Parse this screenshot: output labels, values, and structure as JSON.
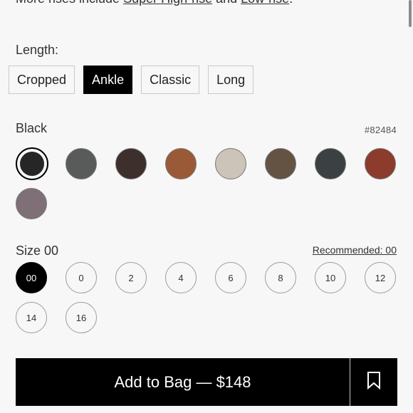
{
  "rise_note": {
    "prefix": "More rises include ",
    "link1": "Super High-rise",
    "middle": " and ",
    "link2": "Low-rise",
    "suffix": "."
  },
  "length": {
    "label": "Length:",
    "options": [
      "Cropped",
      "Ankle",
      "Classic",
      "Long"
    ],
    "selected": "Ankle"
  },
  "color": {
    "name": "Black",
    "code": "#82484",
    "swatches": [
      {
        "color": "#262626",
        "selected": true
      },
      {
        "color": "#595b5b"
      },
      {
        "color": "#3c2f2c"
      },
      {
        "color": "#9a5a37"
      },
      {
        "color": "#ccc4b8"
      },
      {
        "color": "#645243"
      },
      {
        "color": "#3b4042"
      },
      {
        "color": "#8c3b2d"
      },
      {
        "color": "#7e7076"
      }
    ]
  },
  "size": {
    "label": "Size 00",
    "recommended": "Recommended: 00",
    "options": [
      "00",
      "0",
      "2",
      "4",
      "6",
      "8",
      "10",
      "12",
      "14",
      "16"
    ],
    "selected": "00"
  },
  "bag": {
    "label": "Add to Bag — $148",
    "bookmark_icon": "bookmark-icon"
  }
}
